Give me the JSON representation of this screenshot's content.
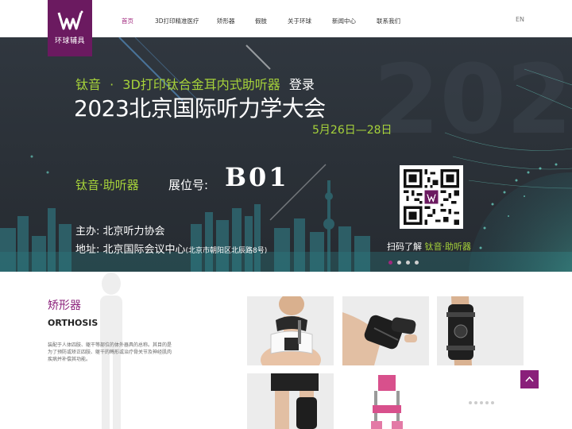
{
  "logo": {
    "text": "环球辅具",
    "brand_color": "#6b1a60"
  },
  "nav": {
    "items": [
      {
        "label": "首页",
        "active": true
      },
      {
        "label": "3D打印精准医疗",
        "active": false
      },
      {
        "label": "矫形器",
        "active": false
      },
      {
        "label": "假肢",
        "active": false
      },
      {
        "label": "关于环球",
        "active": false
      },
      {
        "label": "新闻中心",
        "active": false
      },
      {
        "label": "联系我们",
        "active": false
      }
    ],
    "active_color": "#a0287e",
    "lang": "EN"
  },
  "banner": {
    "line1_brand": "钛音",
    "line1_sep": "·",
    "line1_rest": "3D打印钛合金耳内式助听器",
    "line1_tail": "登录",
    "line2": "2023北京国际听力学大会",
    "date": "5月26日—28日",
    "brand": "钛音·助听器",
    "booth_label": "展位号:",
    "booth": "B01",
    "organizer": "主办: 北京听力协会",
    "address": "地址: 北京国际会议中心",
    "address_detail": "(北京市朝阳区北辰路8号)",
    "qr_caption_pre": "扫码了解",
    "qr_caption_brand": "钛音·助听器",
    "highlight_color": "#a6d23a",
    "slide_count": 4,
    "active_slide": 1
  },
  "section": {
    "title": "矫形器",
    "subtitle": "ORTHOSIS",
    "description": "装配于人体四肢、躯干等部位的体外器具的总称。其目的是为了预防或矫正四肢、躯干的畸形或治疗骨关节及神经肌肉疾病并补偿其功能。",
    "accent_color": "#8a1f7a",
    "thumbnails": [
      "neck-brace",
      "wrist-brace",
      "knee-brace",
      "leg-orthosis",
      "kafo-orthosis"
    ]
  }
}
